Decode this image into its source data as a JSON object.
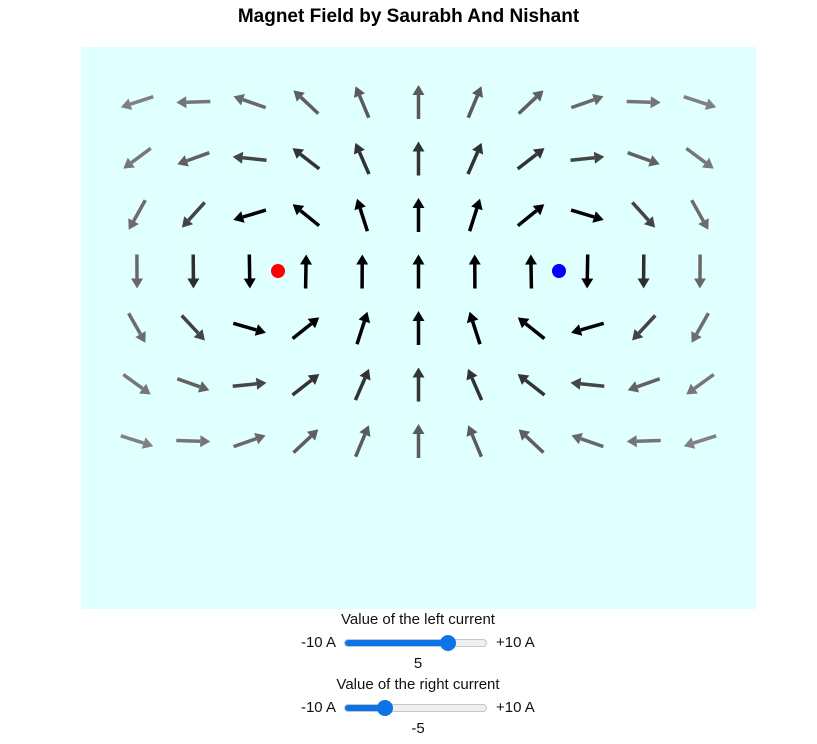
{
  "title": "Magnet Field by Saurabh And Nishant",
  "colors": {
    "background": "#e0ffff",
    "left_wire": "#ff0000",
    "right_wire": "#0000ff",
    "slider_accent": "#0d74e7"
  },
  "wires": {
    "left_icon": "red-dot",
    "right_icon": "blue-dot"
  },
  "controls": {
    "left": {
      "label": "Value of the left current",
      "min_label": "-10 A",
      "max_label": "+10 A",
      "min": -10,
      "max": 10,
      "value": 5,
      "value_text": "5"
    },
    "right": {
      "label": "Value of the right current",
      "min_label": "-10 A",
      "max_label": "+10 A",
      "min": -10,
      "max": 10,
      "value": -5,
      "value_text": "-5"
    }
  }
}
